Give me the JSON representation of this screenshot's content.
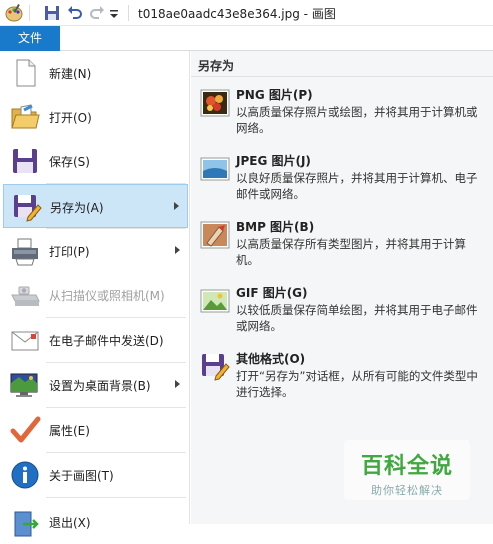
{
  "titlebar": {
    "title": "t018ae0aadc43e8e364.jpg - 画图",
    "app_icon": "paint-app-icon",
    "save_icon": "save-icon",
    "undo_icon": "undo-icon",
    "redo_icon": "redo-icon",
    "qat_dropdown_icon": "chevron-down-icon"
  },
  "file_tab": {
    "label": "文件",
    "color": "#1979ca"
  },
  "menu": {
    "items": [
      {
        "label": "新建(N)",
        "icon": "new-file-icon"
      },
      {
        "label": "打开(O)",
        "icon": "open-folder-icon"
      },
      {
        "label": "保存(S)",
        "icon": "save-disk-icon"
      },
      {
        "label": "另存为(A)",
        "icon": "save-as-icon",
        "active": true,
        "submenu": true
      },
      {
        "label": "打印(P)",
        "icon": "printer-icon",
        "submenu": true
      },
      {
        "label": "从扫描仪或照相机(M)",
        "icon": "scanner-icon",
        "disabled": true
      },
      {
        "label": "在电子邮件中发送(D)",
        "icon": "email-icon"
      },
      {
        "label": "设置为桌面背景(B)",
        "icon": "desktop-background-icon",
        "submenu": true
      },
      {
        "label": "属性(E)",
        "icon": "checkmark-icon"
      },
      {
        "label": "关于画图(T)",
        "icon": "info-icon"
      },
      {
        "label": "退出(X)",
        "icon": "exit-icon"
      }
    ]
  },
  "submenu": {
    "header": "另存为",
    "options": [
      {
        "title": "PNG 图片(P)",
        "desc": "以高质量保存照片或绘图，并将其用于计算机或网络。",
        "icon": "png-image-icon"
      },
      {
        "title": "JPEG 图片(J)",
        "desc": "以良好质量保存照片，并将其用于计算机、电子邮件或网络。",
        "icon": "jpeg-image-icon"
      },
      {
        "title": "BMP 图片(B)",
        "desc": "以高质量保存所有类型图片，并将其用于计算机。",
        "icon": "bmp-image-icon"
      },
      {
        "title": "GIF 图片(G)",
        "desc": "以较低质量保存简单绘图，并将其用于电子邮件或网络。",
        "icon": "gif-image-icon"
      },
      {
        "title": "其他格式(O)",
        "desc": "打开“另存为”对话框，从所有可能的文件类型中进行选择。",
        "icon": "other-formats-icon"
      }
    ]
  },
  "watermark": {
    "brand": "百科全说",
    "slogan": "助你轻松解决"
  }
}
